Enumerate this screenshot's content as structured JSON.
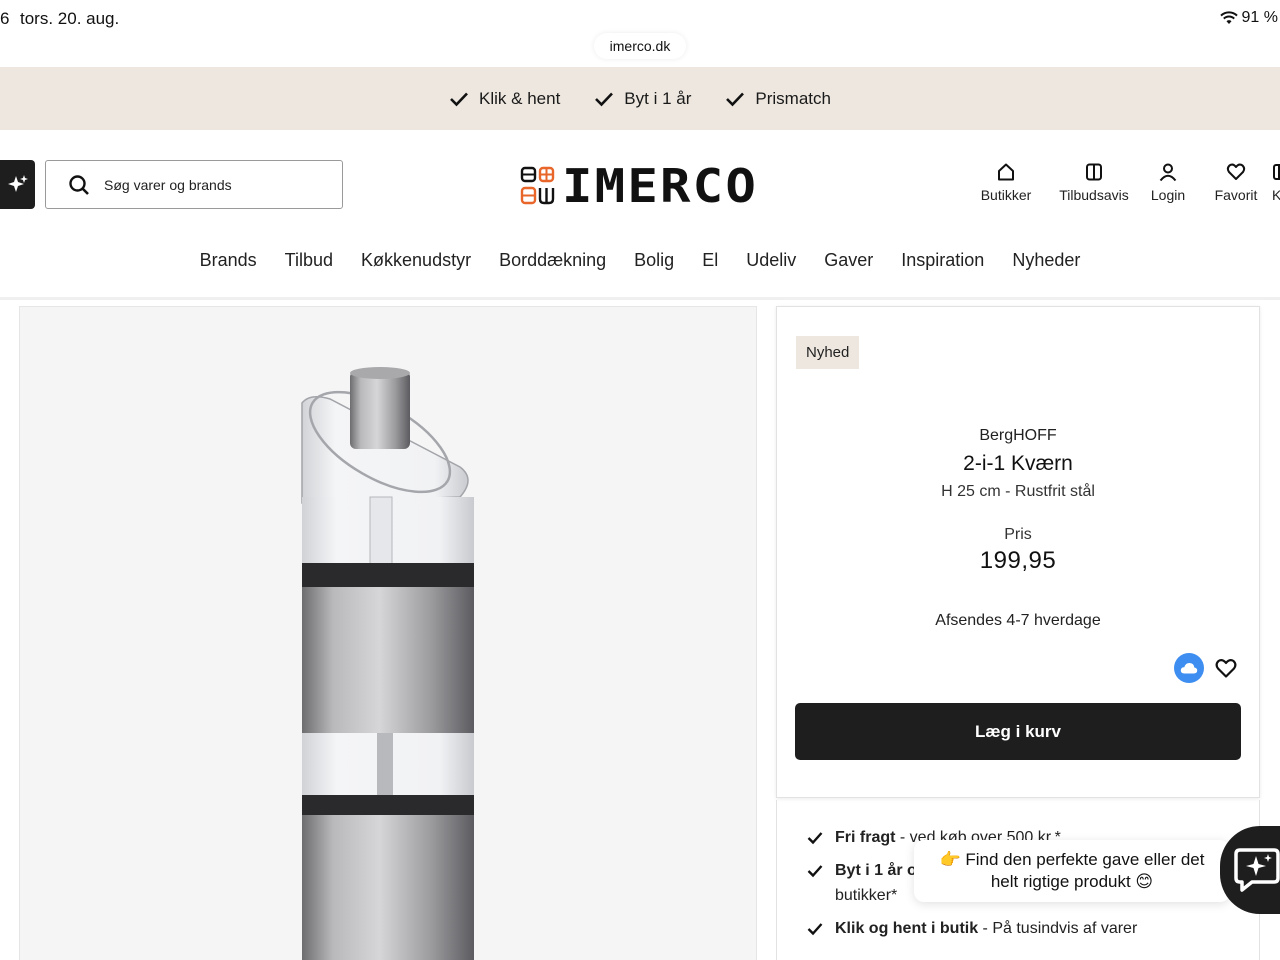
{
  "status_bar": {
    "time_fragment": "6",
    "date": "tors. 20. aug.",
    "battery": "91 %"
  },
  "browser": {
    "url": "imerco.dk"
  },
  "usp_bar": {
    "items": [
      {
        "label": "Klik & hent"
      },
      {
        "label": "Byt i 1 år"
      },
      {
        "label": "Prismatch"
      }
    ]
  },
  "header": {
    "search_placeholder": "Søg varer og brands",
    "logo_text": "IMERCO",
    "icons": [
      {
        "label": "Butikker",
        "icon": "store-icon"
      },
      {
        "label": "Tilbudsavis",
        "icon": "catalog-icon"
      },
      {
        "label": "Login",
        "icon": "user-icon"
      },
      {
        "label": "Favorit",
        "icon": "heart-icon"
      },
      {
        "label": "Kur",
        "icon": "cart-icon"
      }
    ]
  },
  "nav": {
    "items": [
      "Brands",
      "Tilbud",
      "Køkkenudstyr",
      "Borddækning",
      "Bolig",
      "El",
      "Udeliv",
      "Gaver",
      "Inspiration",
      "Nyheder"
    ]
  },
  "product": {
    "badge": "Nyhed",
    "brand": "BergHOFF",
    "name": "2-i-1 Kværn",
    "description": "H 25 cm - Rustfrit stål",
    "price_label": "Pris",
    "price": "199,95",
    "shipping": "Afsendes 4-7 hverdage",
    "add_to_cart": "Læg i kurv"
  },
  "benefits": [
    {
      "title": "Fri fragt",
      "text": " - ved køb over 500 kr.*"
    },
    {
      "title": "Byt i 1 år og",
      "text": "",
      "text2": "butikker*"
    },
    {
      "title": "Klik og hent i butik",
      "text": " - På tusindvis af varer"
    }
  ],
  "chat": {
    "popup_line1": "👉 Find den perfekte gave eller det",
    "popup_line2": "helt rigtige produkt 😊"
  },
  "colors": {
    "usp_background": "#ede7df",
    "button_dark": "#1e1e1e",
    "cloud_blue": "#3d8ef0",
    "logo_orange": "#e8662a"
  }
}
